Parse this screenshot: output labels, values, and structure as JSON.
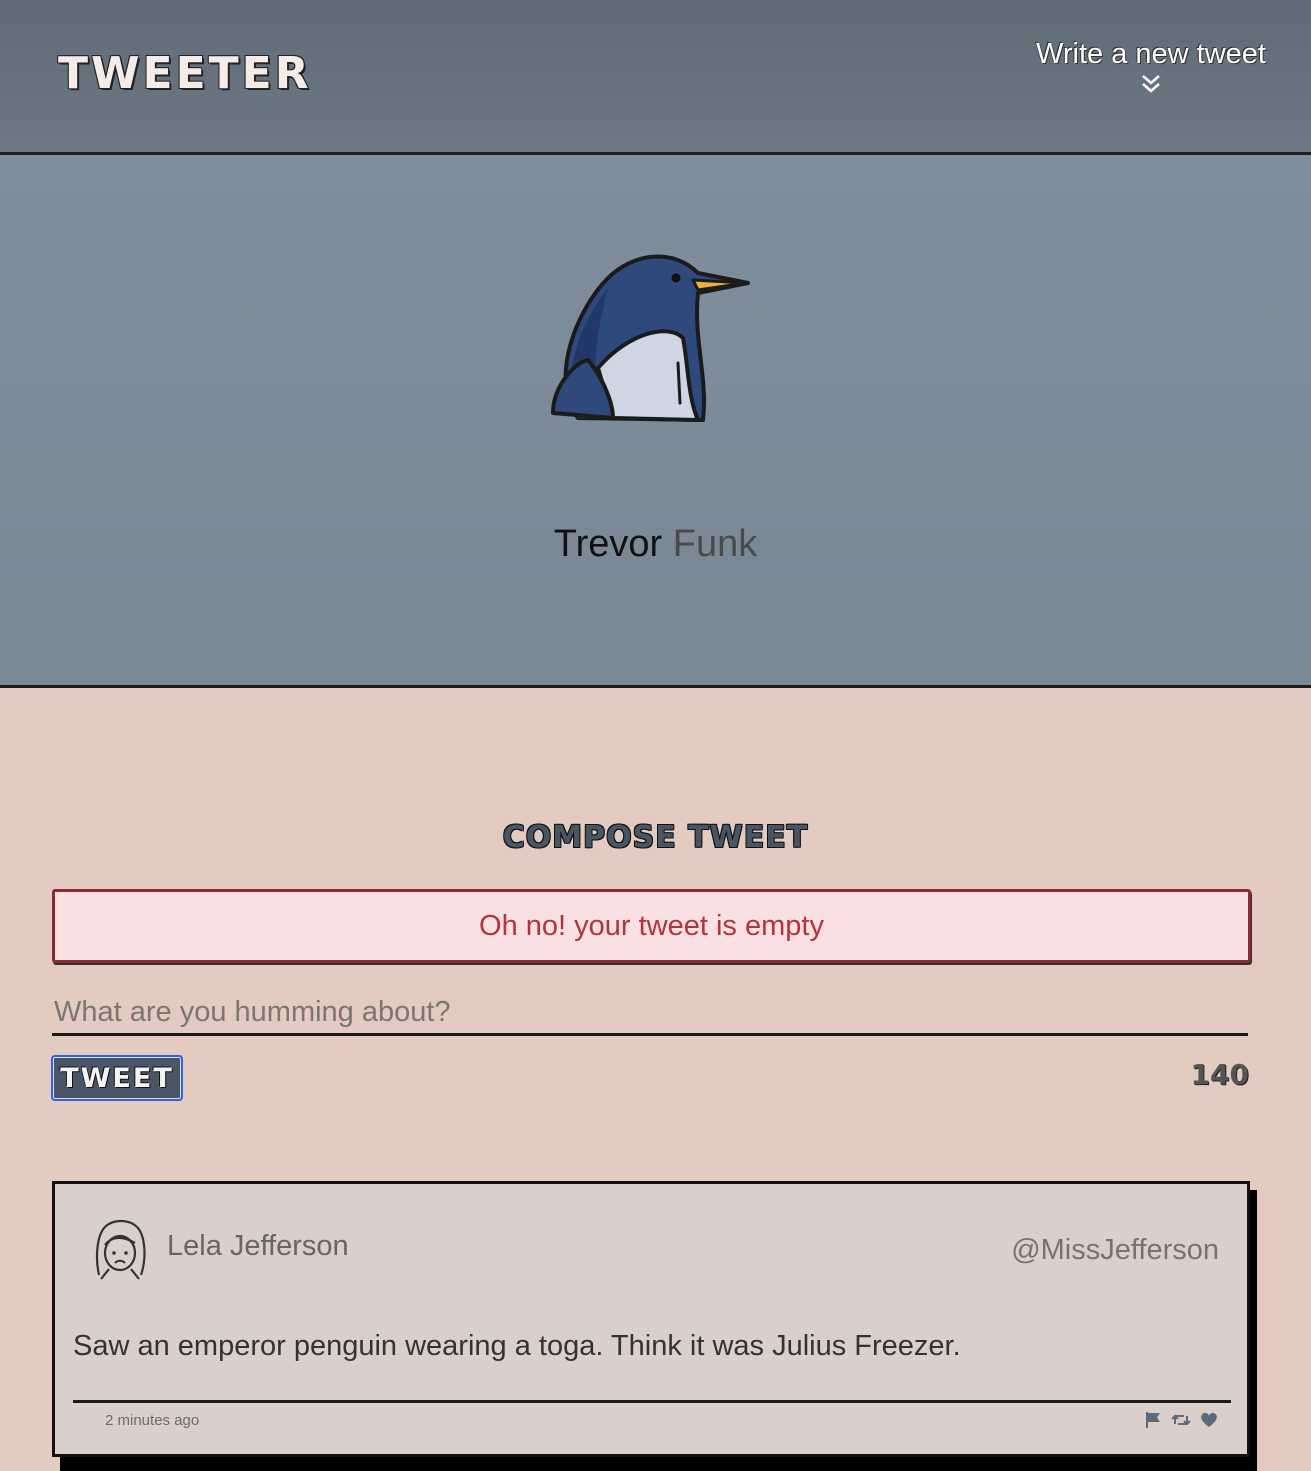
{
  "nav": {
    "logo": "TWEETER",
    "new_tweet_label": "Write a new tweet",
    "new_tweet_icon": "double-chevron-down-icon"
  },
  "profile": {
    "avatar_icon": "penguin-avatar",
    "first_name": "Trevor",
    "last_name": "Funk"
  },
  "compose": {
    "title": "COMPOSE TWEET",
    "error": "Oh no! your tweet is empty",
    "placeholder": "What are you humming about?",
    "value": "",
    "submit_label": "TWEET",
    "counter": "140"
  },
  "tweets": [
    {
      "avatar_icon": "girl-avatar-icon",
      "name": "Lela Jefferson",
      "handle": "@MissJefferson",
      "text": "Saw an emperor penguin wearing a toga. Think it was Julius Freezer.",
      "time": "2 minutes ago",
      "actions": [
        "flag-icon",
        "retweet-icon",
        "heart-icon"
      ]
    }
  ],
  "colors": {
    "nav_bg": "#65717d",
    "profile_bg": "#7e8c9a",
    "page_bg": "#e3cbc1",
    "error_text": "#b4343c",
    "error_bg": "#f9e0e2",
    "button_bg": "#4a5566"
  }
}
